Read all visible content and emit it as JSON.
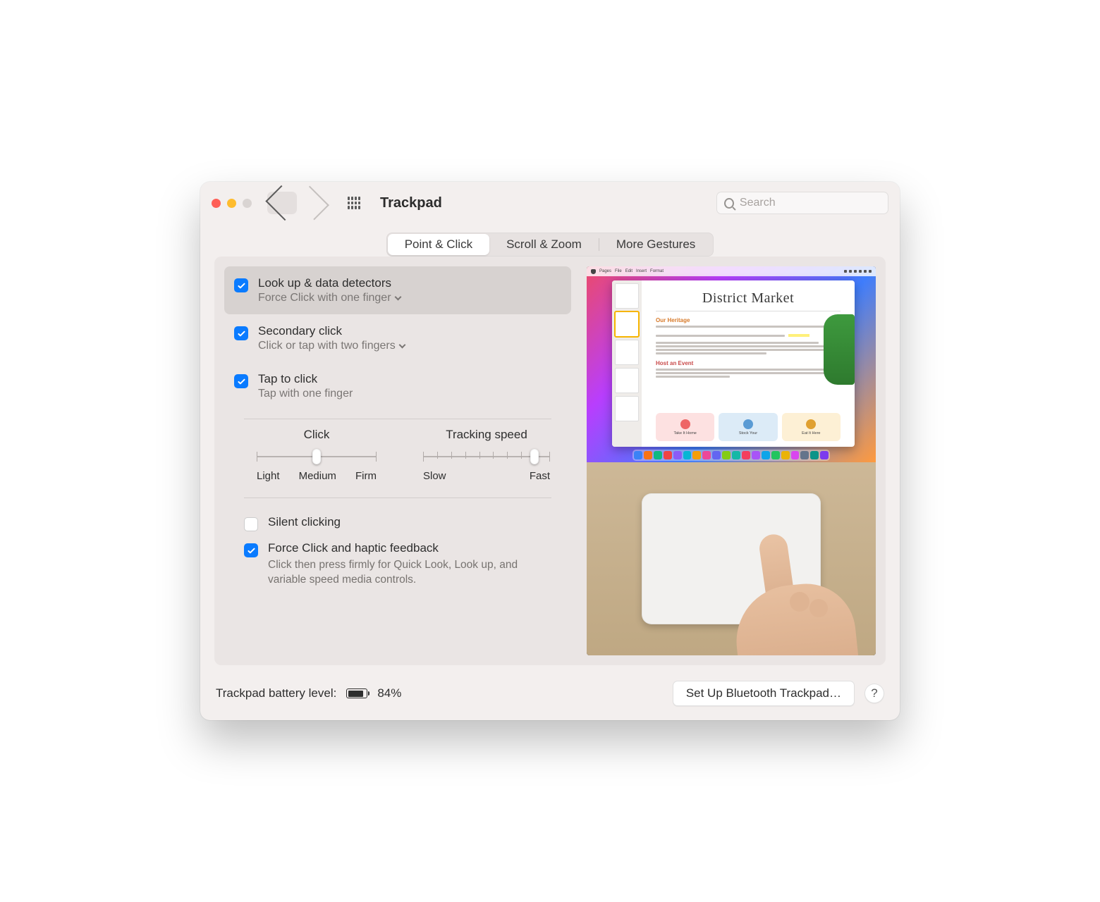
{
  "header": {
    "title": "Trackpad",
    "search_placeholder": "Search"
  },
  "tabs": [
    {
      "label": "Point & Click",
      "active": true
    },
    {
      "label": "Scroll & Zoom",
      "active": false
    },
    {
      "label": "More Gestures",
      "active": false
    }
  ],
  "options": {
    "lookup": {
      "checked": true,
      "title": "Look up & data detectors",
      "subtitle": "Force Click with one finger"
    },
    "secondary_click": {
      "checked": true,
      "title": "Secondary click",
      "subtitle": "Click or tap with two fingers"
    },
    "tap_to_click": {
      "checked": true,
      "title": "Tap to click",
      "subtitle": "Tap with one finger"
    },
    "silent_clicking": {
      "checked": false,
      "title": "Silent clicking"
    },
    "force_click": {
      "checked": true,
      "title": "Force Click and haptic feedback",
      "desc": "Click then press firmly for Quick Look, Look up, and variable speed media controls."
    }
  },
  "sliders": {
    "click": {
      "title": "Click",
      "labels": [
        "Light",
        "Medium",
        "Firm"
      ],
      "steps": 3,
      "value_index": 1
    },
    "tracking": {
      "title": "Tracking speed",
      "labels": [
        "Slow",
        "Fast"
      ],
      "steps": 10,
      "value_index": 8
    }
  },
  "preview": {
    "doc_title": "District Market",
    "section1": "Our Heritage",
    "section2": "Host an Event",
    "cards": [
      "Take It Home",
      "Stock Your",
      "Eat It Here"
    ],
    "dock_colors": [
      "#3b82f6",
      "#f97316",
      "#10b981",
      "#ef4444",
      "#8b5cf6",
      "#06b6d4",
      "#f59e0b",
      "#ec4899",
      "#6366f1",
      "#84cc16",
      "#14b8a6",
      "#f43f5e",
      "#a855f7",
      "#0ea5e9",
      "#22c55e",
      "#eab308",
      "#d946ef",
      "#64748b",
      "#0d9488",
      "#7c3aed"
    ]
  },
  "footer": {
    "battery_label": "Trackpad battery level:",
    "battery_pct": "84%",
    "battery_fill_pct": 84,
    "setup_button": "Set Up Bluetooth Trackpad…",
    "help": "?"
  }
}
